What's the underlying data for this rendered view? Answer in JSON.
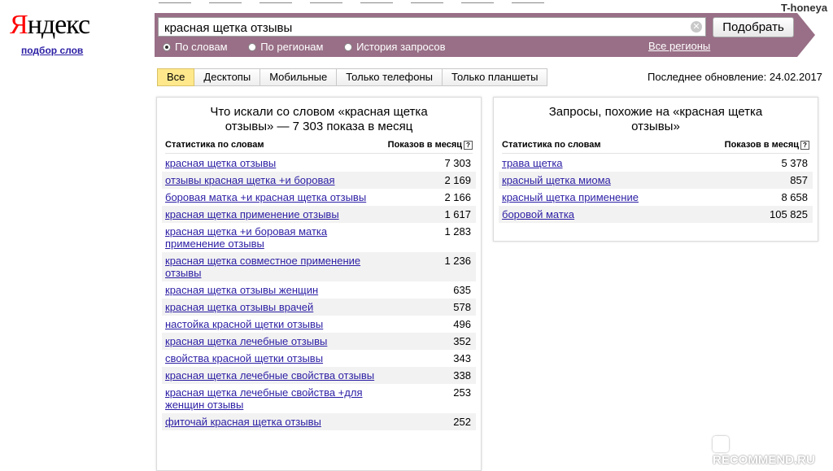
{
  "logo": {
    "first": "Я",
    "rest": "ндекс",
    "sub": "подбор слов"
  },
  "user": "T-honeya",
  "search": {
    "value": "красная щетка отзывы",
    "button": "Подобрать"
  },
  "modes": [
    {
      "label": "По словам",
      "selected": true
    },
    {
      "label": "По регионам",
      "selected": false
    },
    {
      "label": "История запросов",
      "selected": false
    }
  ],
  "regions_link": "Все регионы",
  "tabs": [
    "Все",
    "Десктопы",
    "Мобильные",
    "Только телефоны",
    "Только планшеты"
  ],
  "active_tab": "Все",
  "updated": "Последнее обновление: 24.02.2017",
  "left": {
    "title": "Что искали со словом «красная щетка отзывы» — 7 303 показа в месяц",
    "col_kw": "Статистика по словам",
    "col_count": "Показов в месяц",
    "rows": [
      {
        "kw": "красная щетка отзывы",
        "count": "7 303"
      },
      {
        "kw": "отзывы красная щетка +и боровая",
        "count": "2 169"
      },
      {
        "kw": "боровая матка +и красная щетка отзывы",
        "count": "2 166"
      },
      {
        "kw": "красная щетка применение отзывы",
        "count": "1 617"
      },
      {
        "kw": "красная щетка +и боровая матка применение отзывы",
        "count": "1 283"
      },
      {
        "kw": "красная щетка совместное применение отзывы",
        "count": "1 236"
      },
      {
        "kw": "красная щетка отзывы женщин",
        "count": "635"
      },
      {
        "kw": "красная щетка отзывы врачей",
        "count": "578"
      },
      {
        "kw": "настойка красной щетки отзывы",
        "count": "496"
      },
      {
        "kw": "красная щетка лечебные отзывы",
        "count": "352"
      },
      {
        "kw": "свойства красной щетки отзывы",
        "count": "343"
      },
      {
        "kw": "красная щетка лечебные свойства отзывы",
        "count": "338"
      },
      {
        "kw": "красная щетка лечебные свойства +для женщин отзывы",
        "count": "253"
      },
      {
        "kw": "фиточай красная щетка отзывы",
        "count": "252"
      }
    ]
  },
  "right": {
    "title": "Запросы, похожие на «красная щетка отзывы»",
    "col_kw": "Статистика по словам",
    "col_count": "Показов в месяц",
    "rows": [
      {
        "kw": "трава щетка",
        "count": "5 378"
      },
      {
        "kw": "красный щетка миома",
        "count": "857"
      },
      {
        "kw": "красный щетка применение",
        "count": "8 658"
      },
      {
        "kw": "боровой матка",
        "count": "105 825"
      }
    ]
  },
  "watermark": "RECOMMEND.RU",
  "colors": {
    "bar": "#986f86",
    "link": "#2b1ea4",
    "active_tab": "#ffe88c",
    "logo_red": "#ff0000"
  }
}
